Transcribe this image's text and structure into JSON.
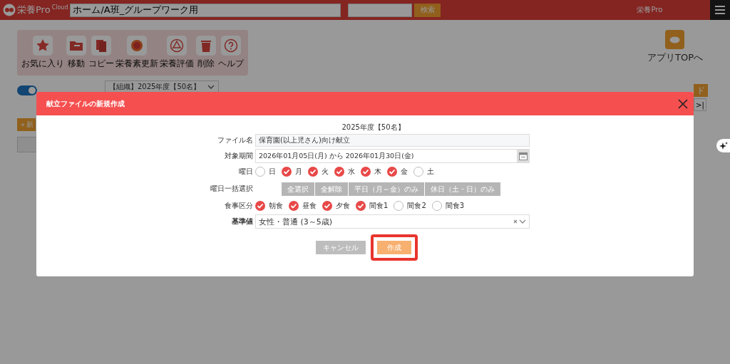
{
  "header": {
    "logo": "栄養Pro",
    "logo_badge": "Cloud",
    "path_field": {
      "value": "ホーム/A班_グループワーク用"
    },
    "search_button": "検索",
    "user": "栄養Pro"
  },
  "toolbar": [
    {
      "kind": "star",
      "label": "お気に入り"
    },
    {
      "kind": "folder",
      "label": "移動"
    },
    {
      "kind": "copy",
      "label": "コピー"
    },
    {
      "kind": "ring",
      "label": "栄養素更新"
    },
    {
      "kind": "triangle",
      "label": "栄養評価"
    },
    {
      "kind": "trash",
      "label": "削除"
    },
    {
      "kind": "help",
      "label": "ヘルプ"
    }
  ],
  "app_link": "アプリTOPへ",
  "background": {
    "toggle": {
      "on": true
    },
    "dropdown": "【組織】2025年度【50名】",
    "new_button": "＋新",
    "right_button": "ド",
    "pager": ">|"
  },
  "dialog": {
    "title": "献立ファイルの新規作成",
    "subtitle": "2025年度【50名】",
    "fields": [
      {
        "kind": "text",
        "label": "ファイル名",
        "value": "保育園(以上児さん)向け献立"
      },
      {
        "kind": "date",
        "label": "対象期間",
        "value": "2026年01月05日(月) から 2026年01月30日(金)"
      },
      {
        "kind": "checks",
        "label": "曜日",
        "options": [
          {
            "label": "日",
            "checked": false
          },
          {
            "label": "月",
            "checked": true
          },
          {
            "label": "火",
            "checked": true
          },
          {
            "label": "水",
            "checked": true
          },
          {
            "label": "木",
            "checked": true
          },
          {
            "label": "金",
            "checked": true
          },
          {
            "label": "土",
            "checked": false
          }
        ]
      },
      {
        "kind": "buttons",
        "label": "曜日一括選択",
        "buttons": [
          "全選択",
          "全解除",
          "平日（月～金）のみ",
          "休日（土・日）のみ"
        ]
      },
      {
        "kind": "checks",
        "label": "食事区分",
        "options": [
          {
            "label": "朝食",
            "checked": true
          },
          {
            "label": "昼食",
            "checked": true
          },
          {
            "label": "夕食",
            "checked": true
          },
          {
            "label": "間食1",
            "checked": true
          },
          {
            "label": "間食2",
            "checked": false
          },
          {
            "label": "間食3",
            "checked": false
          }
        ]
      },
      {
        "kind": "select",
        "label": "基準値",
        "bold": true,
        "value": "女性・普通 (3～5歳)"
      }
    ],
    "actions": [
      {
        "kind": "cancel",
        "label": "キャンセル",
        "highlighted": false
      },
      {
        "kind": "primary",
        "label": "作成",
        "highlighted": true
      }
    ]
  }
}
